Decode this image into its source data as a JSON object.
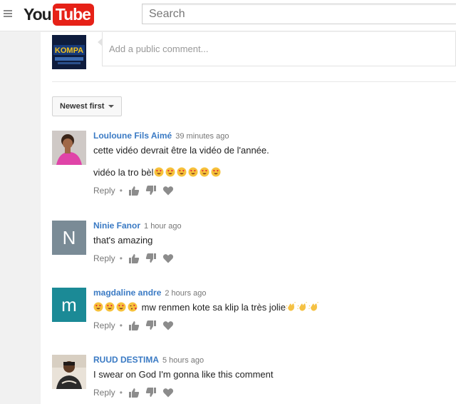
{
  "header": {
    "logo_you": "You",
    "logo_tube": "Tube",
    "search_placeholder": "Search"
  },
  "composer": {
    "placeholder": "Add a public comment...",
    "avatar_text": "KOMPA"
  },
  "sort": {
    "label": "Newest first"
  },
  "comments": [
    {
      "author": "Louloune Fils Aimé",
      "time": "39 minutes ago",
      "text": "cette vidéo devrait être la vidéo de l'année.",
      "text2": "vidéo la tro bèl",
      "reply": "Reply"
    },
    {
      "author": "Ninie Fanor",
      "time": "1 hour ago",
      "avatar_letter": "N",
      "avatar_color": "#7a8b96",
      "text": "that's amazing",
      "reply": "Reply"
    },
    {
      "author": "magdaline andre",
      "time": "2 hours ago",
      "avatar_letter": "m",
      "avatar_color": "#1b8a96",
      "text": "mw renmen kote sa klip la très jolie",
      "reply": "Reply"
    },
    {
      "author": "RUUD DESTIMA",
      "time": "5 hours ago",
      "text": "I swear on God I'm gonna like this comment",
      "reply": "Reply"
    }
  ],
  "icons": {
    "like": "thumbs-up-icon",
    "dislike": "thumbs-down-icon",
    "heart": "heart-icon",
    "menu": "hamburger-menu-icon"
  },
  "colors": {
    "brand_red": "#e62117",
    "author_blue": "#3a7ac4"
  }
}
